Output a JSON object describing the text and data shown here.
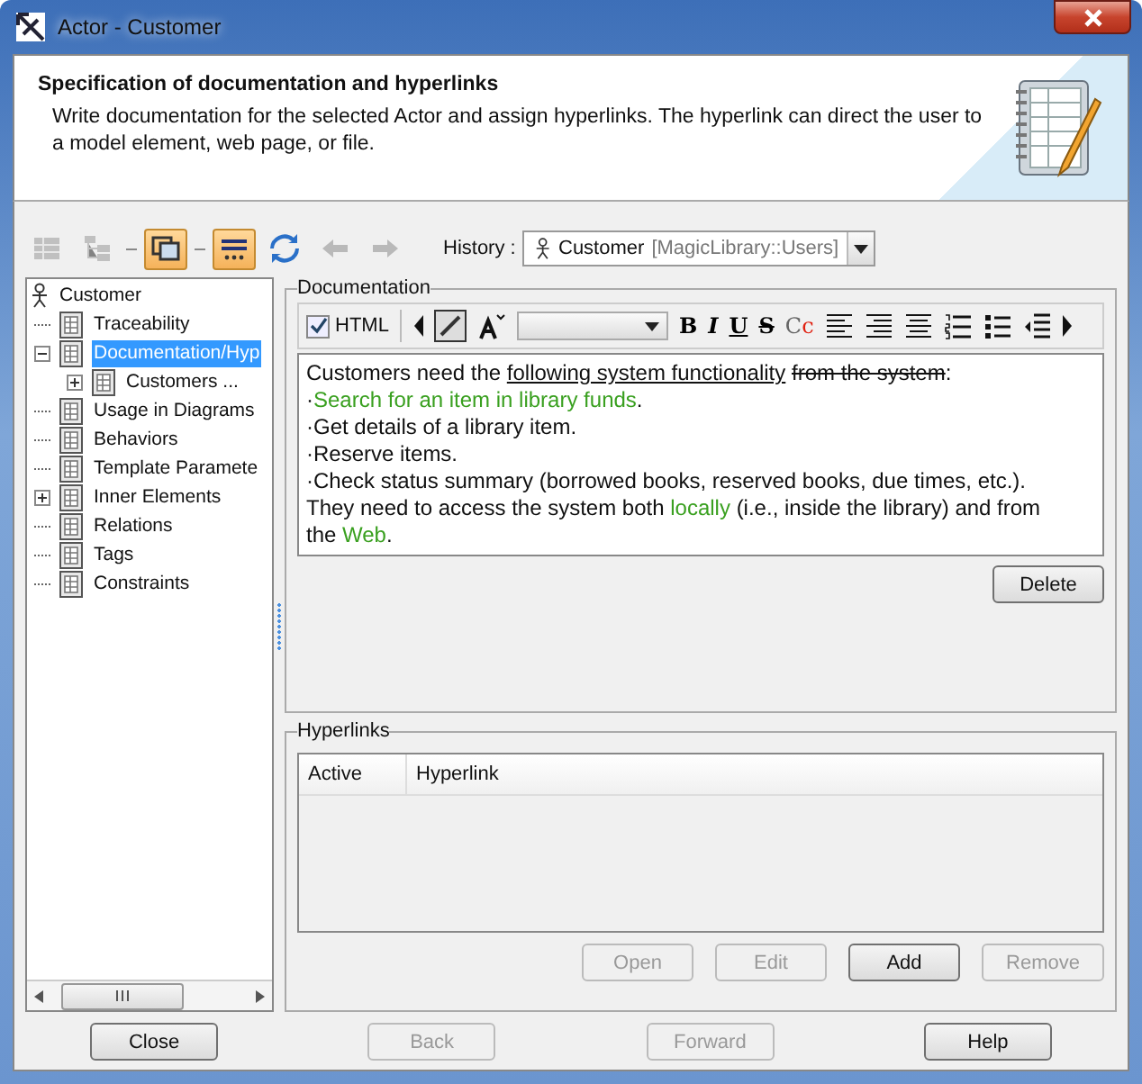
{
  "window": {
    "title": "Actor - Customer"
  },
  "header": {
    "title": "Specification of documentation and hyperlinks",
    "description": "Write documentation for the selected Actor and assign hyperlinks. The hyperlink can direct the user to a model element, web page, or file."
  },
  "toolbar": [
    {
      "kind": "table",
      "disabled": true,
      "selected": false
    },
    {
      "kind": "tree",
      "disabled": true,
      "selected": false
    },
    {
      "kind": "sep"
    },
    {
      "kind": "windows",
      "disabled": false,
      "selected": true
    },
    {
      "kind": "sep"
    },
    {
      "kind": "spell",
      "disabled": false,
      "selected": true
    },
    {
      "kind": "refresh",
      "disabled": false,
      "selected": false
    },
    {
      "kind": "back",
      "disabled": true,
      "selected": false
    },
    {
      "kind": "forward",
      "disabled": true,
      "selected": false
    }
  ],
  "history": {
    "label": "History :",
    "value": "Customer",
    "qualifier": "[MagicLibrary::Users]"
  },
  "tree": {
    "label": "Customer",
    "children": [
      {
        "label": "Traceability",
        "selected": false
      },
      {
        "label": "Documentation/Hyp",
        "selected": true,
        "expanded": true,
        "children": [
          {
            "label": "Customers ...",
            "selected": false,
            "expanded": false
          }
        ]
      },
      {
        "label": "Usage in Diagrams",
        "selected": false
      },
      {
        "label": "Behaviors",
        "selected": false
      },
      {
        "label": "Template Paramete",
        "selected": false
      },
      {
        "label": "Inner Elements",
        "selected": false,
        "expanded": false
      },
      {
        "label": "Relations",
        "selected": false
      },
      {
        "label": "Tags",
        "selected": false
      },
      {
        "label": "Constraints",
        "selected": false
      }
    ]
  },
  "documentation": {
    "title": "Documentation",
    "html": {
      "label": "HTML",
      "checked": true
    },
    "format_buttons": [
      {
        "kind": "bold",
        "label": "B"
      },
      {
        "kind": "italic",
        "label": "I"
      },
      {
        "kind": "underline",
        "label": "U"
      },
      {
        "kind": "strike",
        "label": "S"
      },
      {
        "kind": "color",
        "label": "Cc"
      }
    ],
    "lines": [
      [
        {
          "text": "Customers need the ",
          "kind": "plain"
        },
        {
          "text": "following system functionality",
          "kind": "underline"
        },
        {
          "text": " from the system",
          "kind": "strike"
        },
        {
          "text": ":",
          "kind": "plain"
        }
      ],
      [
        {
          "text": "·",
          "kind": "plain"
        },
        {
          "text": "Search for an item in library funds",
          "kind": "link"
        },
        {
          "text": ".",
          "kind": "plain"
        }
      ],
      [
        {
          "text": "·Get details of a library item.",
          "kind": "plain"
        }
      ],
      [
        {
          "text": "·Reserve items.",
          "kind": "plain"
        }
      ],
      [
        {
          "text": "·Check status summary (borrowed books, reserved books, due times, etc.).",
          "kind": "plain"
        }
      ],
      [
        {
          "text": "They need to access the system both ",
          "kind": "plain"
        },
        {
          "text": "locally",
          "kind": "link"
        },
        {
          "text": " (i.e., inside the library) and from",
          "kind": "plain"
        }
      ],
      [
        {
          "text": "the ",
          "kind": "plain"
        },
        {
          "text": "Web",
          "kind": "link"
        },
        {
          "text": ".",
          "kind": "plain"
        }
      ]
    ],
    "delete_button": "Delete"
  },
  "hyperlinks": {
    "title": "Hyperlinks",
    "columns": [
      "Active",
      "Hyperlink"
    ],
    "buttons": [
      {
        "label": "Open",
        "disabled": true
      },
      {
        "label": "Edit",
        "disabled": true
      },
      {
        "label": "Add",
        "disabled": false
      },
      {
        "label": "Remove",
        "disabled": true
      }
    ]
  },
  "footer_buttons": [
    {
      "label": "Close",
      "disabled": false
    },
    {
      "label": "Back",
      "disabled": true
    },
    {
      "label": "Forward",
      "disabled": true
    },
    {
      "label": "Help",
      "disabled": false
    }
  ]
}
